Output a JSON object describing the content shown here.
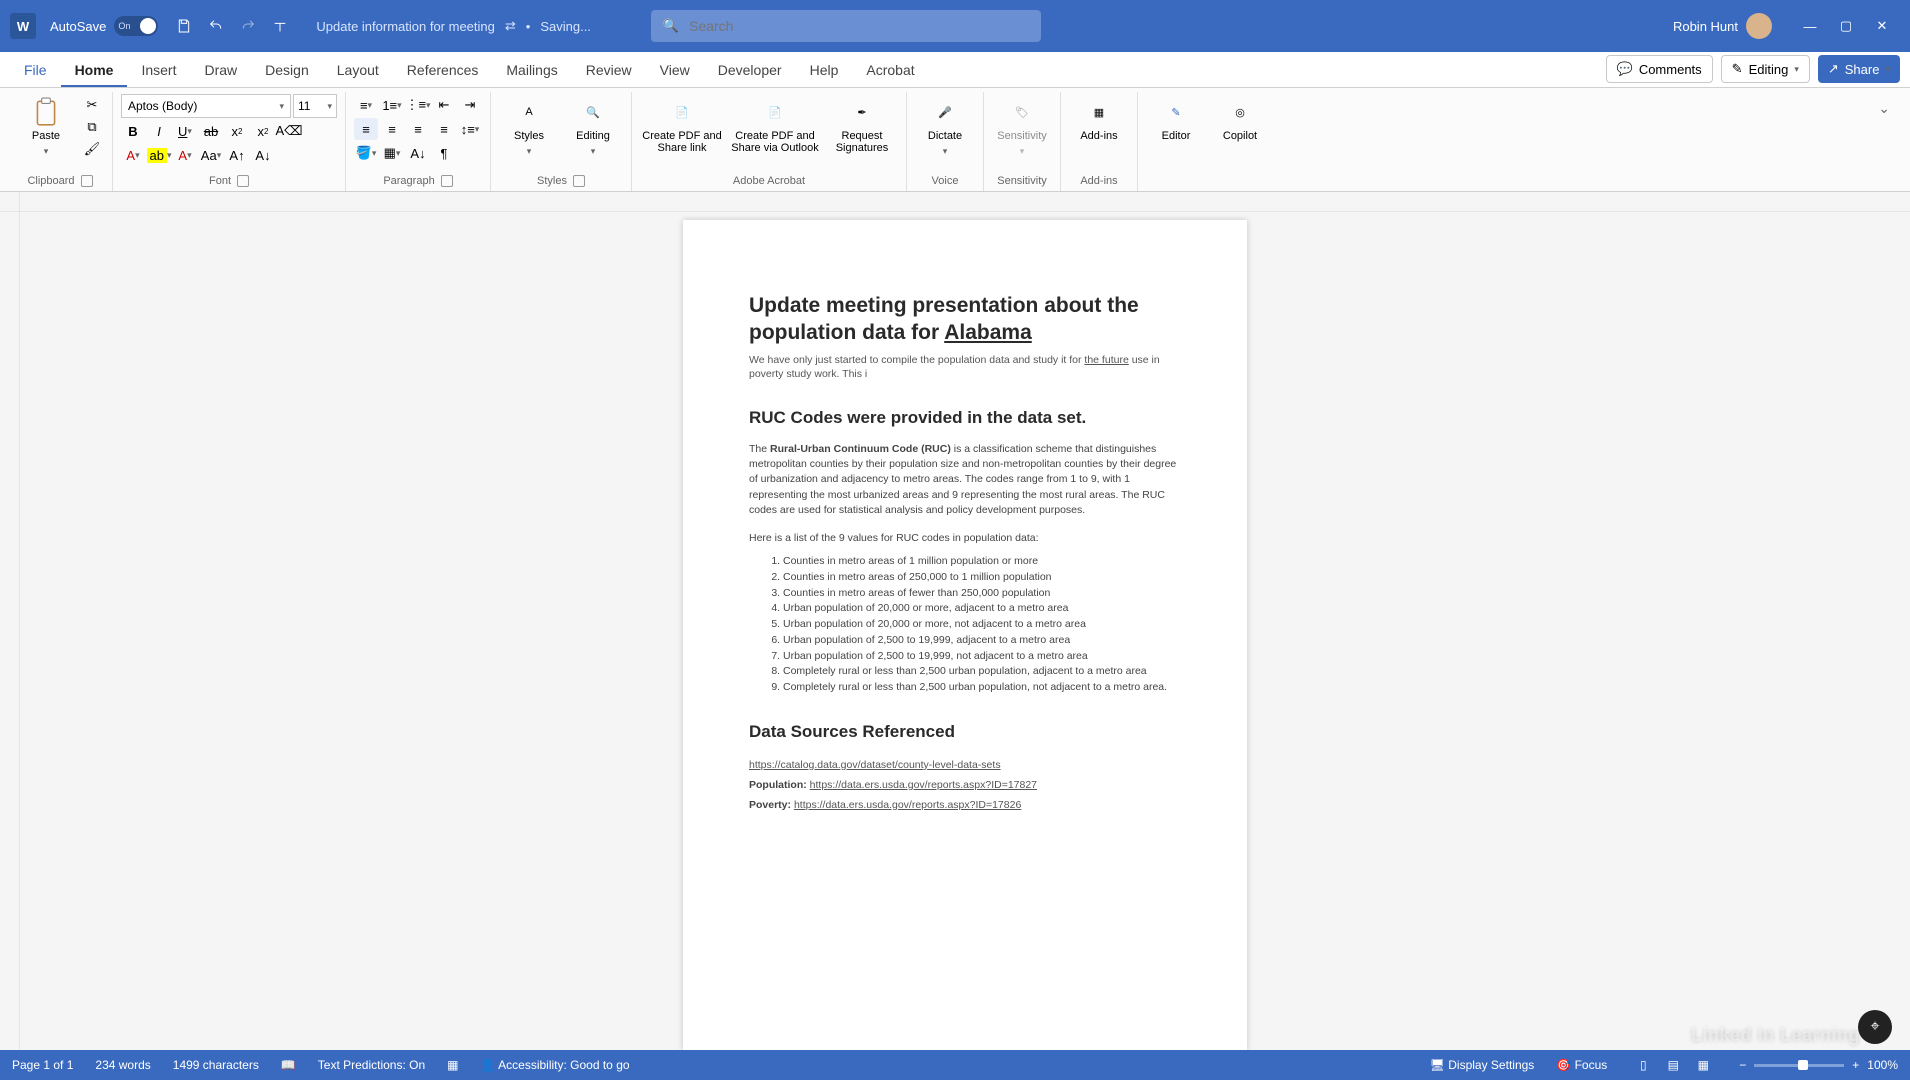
{
  "titlebar": {
    "autosave": "AutoSave",
    "autosave_state": "On",
    "doc_title": "Update information for meeting",
    "saving": "Saving...",
    "search_placeholder": "Search",
    "user_name": "Robin Hunt"
  },
  "menu": {
    "file": "File",
    "tabs": [
      "Home",
      "Insert",
      "Draw",
      "Design",
      "Layout",
      "References",
      "Mailings",
      "Review",
      "View",
      "Developer",
      "Help",
      "Acrobat"
    ],
    "active": "Home",
    "comments": "Comments",
    "editing": "Editing",
    "share": "Share"
  },
  "ribbon": {
    "clipboard": {
      "paste": "Paste",
      "label": "Clipboard"
    },
    "font": {
      "name": "Aptos (Body)",
      "size": "11",
      "label": "Font"
    },
    "paragraph": {
      "label": "Paragraph"
    },
    "styles": {
      "button": "Styles",
      "label": "Styles"
    },
    "editing": {
      "button": "Editing"
    },
    "acrobat": {
      "pdf_share_link": "Create PDF and Share link",
      "pdf_outlook": "Create PDF and Share via Outlook",
      "signatures": "Request Signatures",
      "label": "Adobe Acrobat"
    },
    "dictate": {
      "button": "Dictate",
      "label": "Voice"
    },
    "sensitivity": {
      "button": "Sensitivity",
      "label": "Sensitivity"
    },
    "addins": {
      "button": "Add-ins",
      "label": "Add-ins"
    },
    "editor": "Editor",
    "copilot": "Copilot"
  },
  "document": {
    "title_a": "Update meeting presentation about the population data for ",
    "title_b": "Alabama",
    "intro_a": "We have only just started to compile the population data and study it for ",
    "intro_b": "the future",
    "intro_c": " use in poverty study work. This i",
    "h2_ruc": "RUC Codes were provided in the data set.",
    "para_the": "The ",
    "para_bold": "Rural-Urban Continuum Code (RUC)",
    "para_rest": " is a classification scheme that distinguishes metropolitan counties by their population size and non-metropolitan counties by their degree of urbanization and adjacency to metro areas. The codes range from 1 to 9, with 1 representing the most urbanized areas and 9 representing the most rural areas. The RUC codes are used for statistical analysis and policy development purposes.",
    "listintro": "Here is a list of the 9 values for RUC codes in population data:",
    "items": [
      "Counties in metro areas of 1 million population or more",
      "Counties in metro areas of 250,000 to 1 million population",
      "Counties in metro areas of fewer than 250,000 population",
      "Urban population of 20,000 or more, adjacent to a metro area",
      "Urban population of 20,000 or more, not adjacent to a metro area",
      "Urban population of 2,500 to 19,999, adjacent to a metro area",
      "Urban population of 2,500 to 19,999, not adjacent to a metro area",
      "Completely rural or less than 2,500 urban population, adjacent to a metro area",
      "Completely rural or less than 2,500 urban population, not adjacent to a metro area."
    ],
    "h2_sources": "Data Sources Referenced",
    "link1": "https://catalog.data.gov/dataset/county-level-data-sets",
    "pop_label": "Population:",
    "link2": "https://data.ers.usda.gov/reports.aspx?ID=17827",
    "pov_label": "Poverty:",
    "link3": "https://data.ers.usda.gov/reports.aspx?ID=17826"
  },
  "status": {
    "page": "Page 1 of 1",
    "words": "234 words",
    "chars": "1499 characters",
    "predictions": "Text Predictions: On",
    "accessibility": "Accessibility: Good to go",
    "display": "Display Settings",
    "focus": "Focus",
    "zoom": "100%"
  },
  "watermark": "Linked in Learning"
}
